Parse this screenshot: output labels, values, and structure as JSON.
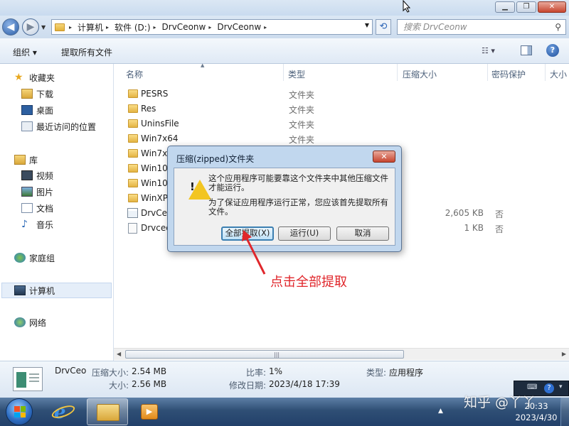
{
  "window": {
    "minimize_label": "▁",
    "restore_label": "❐",
    "close_label": "✕"
  },
  "address": {
    "crumbs": [
      "计算机",
      "软件 (D:)",
      "DrvCeonw",
      "DrvCeonw"
    ],
    "search_placeholder": "搜索 DrvCeonw"
  },
  "toolbar": {
    "organize_label": "组织 ▾",
    "extract_all_label": "提取所有文件"
  },
  "navpane": {
    "favorites": "收藏夹",
    "downloads": "下载",
    "desktop": "桌面",
    "recent": "最近访问的位置",
    "libraries": "库",
    "videos": "视频",
    "pictures": "图片",
    "documents": "文档",
    "music": "音乐",
    "homegroup": "家庭组",
    "computer": "计算机",
    "network": "网络"
  },
  "columns": {
    "name": "名称",
    "type": "类型",
    "compressed_size": "压缩大小",
    "password": "密码保护",
    "size": "大小"
  },
  "files": [
    {
      "name": "PESRS",
      "type": "文件夹",
      "size": "",
      "protected": "",
      "icon": "folder"
    },
    {
      "name": "Res",
      "type": "文件夹",
      "size": "",
      "protected": "",
      "icon": "folder"
    },
    {
      "name": "UninsFile",
      "type": "文件夹",
      "size": "",
      "protected": "",
      "icon": "folder"
    },
    {
      "name": "Win7x64",
      "type": "文件夹",
      "size": "",
      "protected": "",
      "icon": "folder"
    },
    {
      "name": "Win7x",
      "type": "",
      "size": "",
      "protected": "",
      "icon": "folder"
    },
    {
      "name": "Win10",
      "type": "",
      "size": "",
      "protected": "",
      "icon": "folder"
    },
    {
      "name": "Win10",
      "type": "",
      "size": "",
      "protected": "",
      "icon": "folder"
    },
    {
      "name": "WinXP",
      "type": "",
      "size": "",
      "protected": "",
      "icon": "folder"
    },
    {
      "name": "DrvCeo",
      "type": "",
      "size": "2,605 KB",
      "protected": "否",
      "icon": "app"
    },
    {
      "name": "Drvceo",
      "type": "",
      "size": "1 KB",
      "protected": "否",
      "icon": "config"
    }
  ],
  "details": {
    "name": "DrvCeo",
    "compressed_label": "压缩大小:",
    "compressed_value": "2.54 MB",
    "size_label": "大小:",
    "size_value": "2.56 MB",
    "ratio_label": "比率:",
    "ratio_value": "1%",
    "modified_label": "修改日期:",
    "modified_value": "2023/4/18 17:39",
    "type_label": "类型:",
    "type_value": "应用程序"
  },
  "dialog": {
    "title": "压缩(zipped)文件夹",
    "message1": "这个应用程序可能要靠这个文件夹中其他压缩文件才能运行。",
    "message2": "为了保证应用程序运行正常，您应该首先提取所有文件。",
    "extract_all_button": "全部提取(X)",
    "run_button": "运行(U)",
    "cancel_button": "取消"
  },
  "annotation": {
    "text": "点击全部提取"
  },
  "taskbar": {
    "time": "20:33",
    "date": "2023/4/30"
  },
  "watermark": {
    "text": "知乎 @丫丫"
  },
  "colors": {
    "annotation_red": "#e0262b",
    "taskbar_blue": "#2f4f75",
    "dialog_frame": "#c1d7ee"
  }
}
